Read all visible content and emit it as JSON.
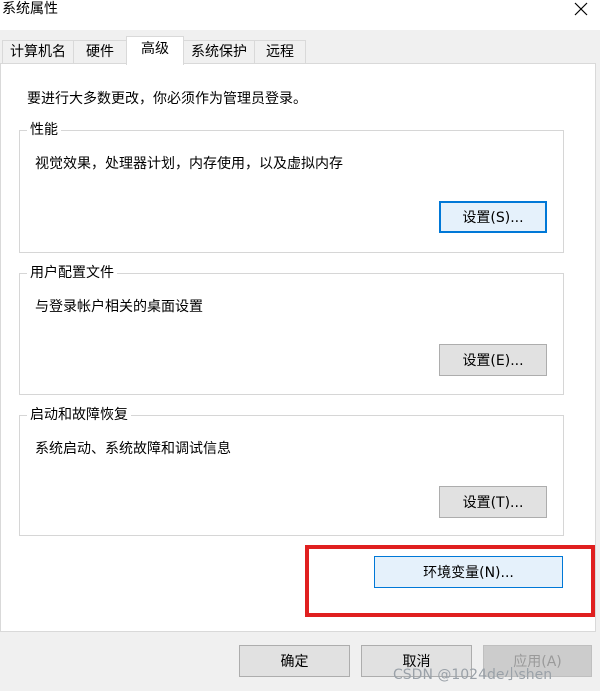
{
  "window": {
    "title": "系统属性"
  },
  "tabs": [
    {
      "label": "计算机名"
    },
    {
      "label": "硬件"
    },
    {
      "label": "高级"
    },
    {
      "label": "系统保护"
    },
    {
      "label": "远程"
    }
  ],
  "intro": "要进行大多数更改，你必须作为管理员登录。",
  "performance": {
    "title": "性能",
    "desc": "视觉效果，处理器计划，内存使用，以及虚拟内存",
    "button": "设置(S)..."
  },
  "profile": {
    "title": "用户配置文件",
    "desc": "与登录帐户相关的桌面设置",
    "button": "设置(E)..."
  },
  "startup": {
    "title": "启动和故障恢复",
    "desc": "系统启动、系统故障和调试信息",
    "button": "设置(T)..."
  },
  "env_button": "环境变量(N)...",
  "footer": {
    "ok": "确定",
    "cancel": "取消",
    "apply": "应用(A)"
  },
  "watermark": "CSDN @1024de小shen",
  "colors": {
    "highlight": "#e02020",
    "focus": "#0078d7"
  },
  "icons": {
    "close": "close-icon"
  }
}
